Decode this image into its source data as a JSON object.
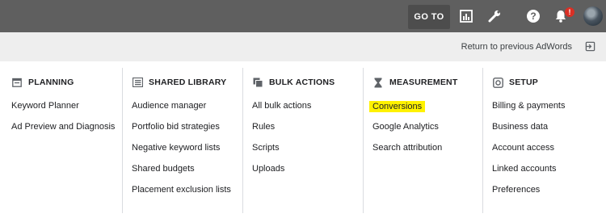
{
  "header": {
    "goto_label": "GO TO",
    "notification_badge": "!",
    "help_glyph": "?"
  },
  "return_bar": {
    "label": "Return to previous AdWords"
  },
  "columns": [
    {
      "title": "PLANNING",
      "icon": "calendar-icon",
      "items": [
        "Keyword Planner",
        "Ad Preview and Diagnosis"
      ]
    },
    {
      "title": "SHARED LIBRARY",
      "icon": "library-icon",
      "items": [
        "Audience manager",
        "Portfolio bid strategies",
        "Negative keyword lists",
        "Shared budgets",
        "Placement exclusion lists"
      ]
    },
    {
      "title": "BULK ACTIONS",
      "icon": "copy-icon",
      "items": [
        "All bulk actions",
        "Rules",
        "Scripts",
        "Uploads"
      ]
    },
    {
      "title": "MEASUREMENT",
      "icon": "hourglass-icon",
      "items": [
        "Conversions",
        "Google Analytics",
        "Search attribution"
      ],
      "highlighted_item": "Conversions",
      "highlight_color": "#fff200"
    },
    {
      "title": "SETUP",
      "icon": "settings-icon",
      "items": [
        "Billing & payments",
        "Business data",
        "Account access",
        "Linked accounts",
        "Preferences"
      ]
    }
  ]
}
